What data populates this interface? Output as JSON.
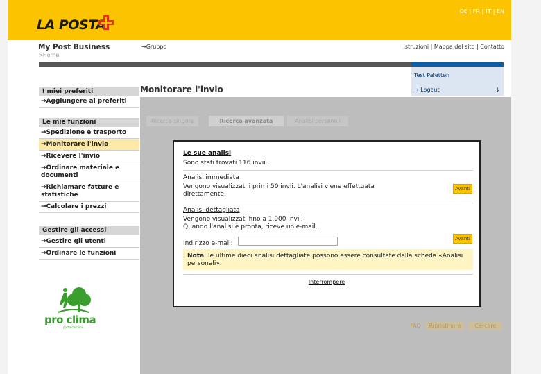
{
  "header": {
    "logo": "LA POSTA",
    "languages": [
      "DE",
      "FR",
      "IT",
      "EN"
    ],
    "active_language": "IT"
  },
  "business": {
    "title": "My Post Business",
    "breadcrumb": ">Home",
    "group_link": "→Gruppo",
    "top_links": "Istruzioni | Mappa del sito | Contatto"
  },
  "user": {
    "name": "Test Paletten",
    "logout": "→ Logout",
    "logout_arrow": "↓"
  },
  "sidebar": {
    "favorites_head": "I miei preferiti",
    "add_favorites": "→Aggiungere ai preferiti",
    "functions_head": "Le mie funzioni",
    "items": [
      "→Spedizione e trasporto",
      "→Monitorare l'invio",
      "→Ricevere l'invio",
      "→Ordinare materiale e documenti",
      "→Richiamare fatture e statistiche",
      "→Calcolare i prezzi"
    ],
    "access_head": "Gestire gli accessi",
    "access_items": [
      "→Gestire gli utenti",
      "→Ordinare le funzioni"
    ]
  },
  "main": {
    "title": "Monitorare l'invio",
    "tabs": [
      "Ricerca singola",
      "Ricerca avanzata",
      "Analisi personali"
    ],
    "bottom_buttons": [
      "FAQ",
      "Ripristinare",
      "Cercare"
    ]
  },
  "dialog": {
    "title": "Le sue analisi",
    "found_text": "Sono stati trovati 116 invii.",
    "immediate_title": "Analisi immediata",
    "immediate_text_1": "Vengono visualizzati i primi 50 invii. L'analisi viene effettuata",
    "immediate_text_2": "direttamente.",
    "detailed_title": "Analisi dettagliata",
    "detailed_text_1": "Vengono visualizzati fino a 1.000 invii.",
    "detailed_text_2": "Quando l'analisi è pronta, riceve un'e-mail.",
    "email_label": "Indirizzo e-mail:",
    "email_value": "",
    "avanti_label": "Avanti",
    "note_label": "Nota",
    "note_text": ": le ultime dieci analisi dettagliate possono essere consultate dalla scheda «Analisi personali».",
    "cancel_label": "Interrompere"
  },
  "promo": {
    "text": "pro clima",
    "subtext": "posta.ch/clima"
  },
  "colors": {
    "brand_yellow": "#fcc300",
    "link_blue": "#0b5ea8",
    "note_bg": "#fef4c4",
    "promo_green": "#3a9e2e"
  }
}
